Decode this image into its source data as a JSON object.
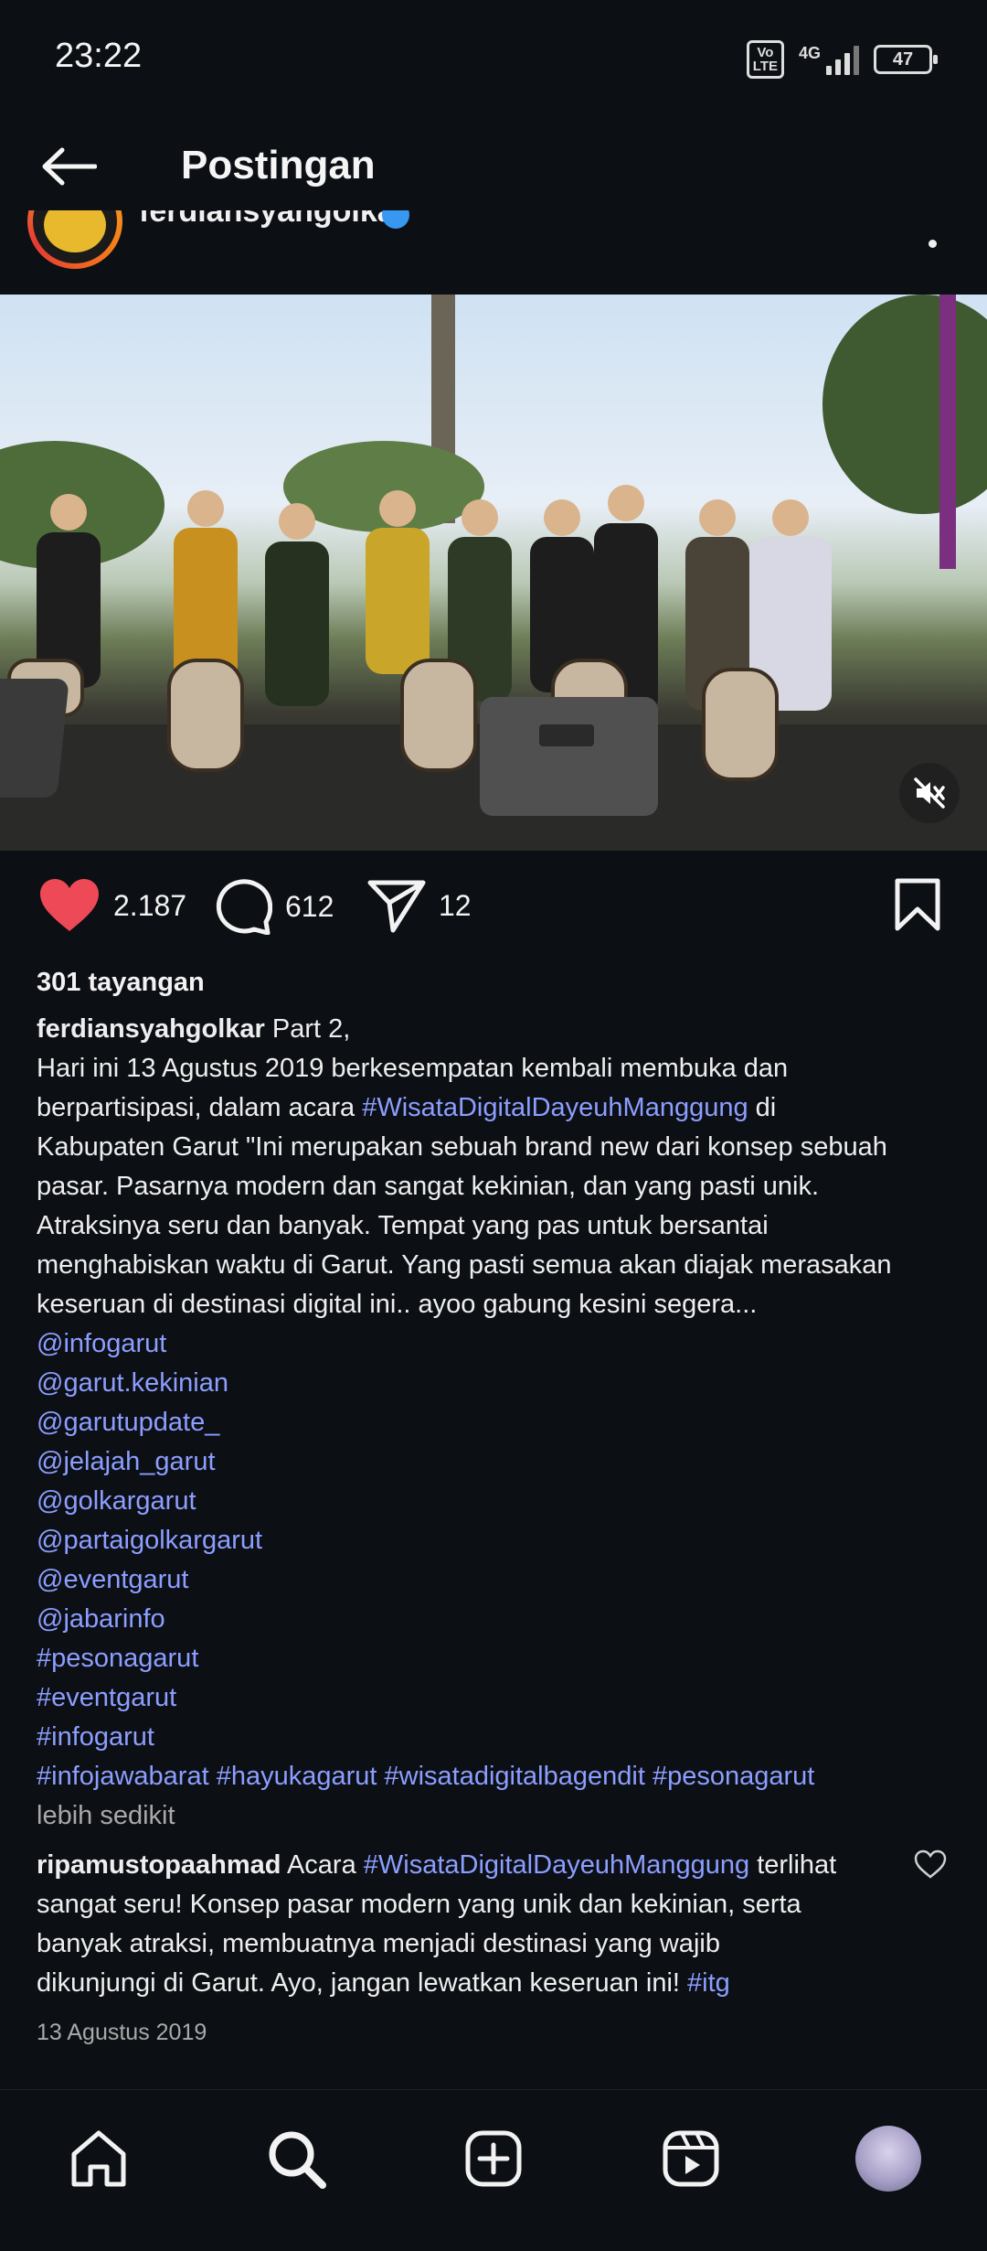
{
  "status_bar": {
    "time": "23:22",
    "volte_line1": "Vo",
    "volte_line2": "LTE",
    "network": "4G",
    "battery": "47"
  },
  "top_bar": {
    "title": "Postingan",
    "back_icon": "arrow-left-icon"
  },
  "post_header": {
    "username": "ferdiansyahgolkar",
    "verified_icon": "verified-badge-icon",
    "more_icon": "more-options-icon"
  },
  "video": {
    "mute_icon": "volume-muted-icon"
  },
  "actions": {
    "like_count": "2.187",
    "comment_count": "612",
    "share_count": "12",
    "like_color": "#ed4956"
  },
  "views": "301 tayangan",
  "caption": {
    "username": "ferdiansyahgolkar",
    "l1": " Part 2,",
    "l2": "Hari ini 13 Agustus 2019 berkesempatan kembali membuka dan",
    "l3_pre": "berpartisipasi, dalam acara ",
    "l3_tag": "#WisataDigitalDayeuhManggung",
    "l3_post": " di",
    "l4": "Kabupaten Garut \"Ini merupakan sebuah brand new dari konsep sebuah",
    "l5": "pasar. Pasarnya modern dan sangat kekinian, dan yang pasti unik.",
    "l6": "Atraksinya seru dan banyak. Tempat yang pas untuk bersantai",
    "l7": "menghabiskan waktu di Garut. Yang pasti semua akan diajak merasakan",
    "l8": "keseruan di destinasi digital ini.. ayoo gabung kesini segera...",
    "mentions": [
      "@infogarut",
      "@garut.kekinian",
      "@garutupdate_",
      "@jelajah_garut",
      "@golkargarut",
      "@partaigolkargarut",
      "@eventgarut",
      "@jabarinfo"
    ],
    "tags": [
      "#pesonagarut",
      "#eventgarut",
      "#infogarut"
    ],
    "tags_line": [
      "#infojawabarat",
      "#hayukagarut",
      "#wisatadigitalbagendit",
      "#pesonagarut"
    ],
    "less": "lebih sedikit"
  },
  "comment": {
    "username": "ripamustopaahmad",
    "l1_pre": " Acara ",
    "l1_tag": "#WisataDigitalDayeuhManggung",
    "l1_post": " terlihat",
    "l2": "sangat seru! Konsep pasar modern yang unik dan kekinian, serta",
    "l3": "banyak atraksi, membuatnya menjadi destinasi yang wajib",
    "l4_pre": "dikunjungi di Garut. Ayo, jangan lewatkan keseruan ini! ",
    "l4_tag": "#itg",
    "like_icon": "heart-outline-icon"
  },
  "post_date": "13 Agustus 2019",
  "bottom_nav": [
    "home-icon",
    "search-icon",
    "create-post-icon",
    "reels-icon",
    "profile-avatar"
  ],
  "colors": {
    "background": "#0c0f14",
    "link": "#8c9eff",
    "muted": "#a9a9a9"
  }
}
